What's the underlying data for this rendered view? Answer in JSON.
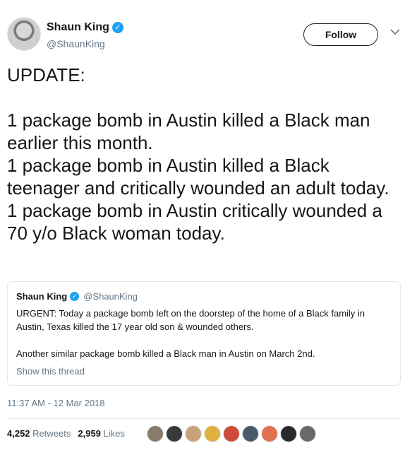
{
  "author": {
    "name": "Shaun King",
    "handle": "@ShaunKing",
    "verified_icon": "verified-badge-icon"
  },
  "actions": {
    "follow_label": "Follow",
    "more_icon": "chevron-down-icon"
  },
  "tweet": {
    "text": "UPDATE:\n\n1 package bomb in Austin killed a Black man earlier this month.\n1 package bomb in Austin killed a Black teenager and critically wounded an adult today.\n1 package bomb in Austin critically wounded a 70 y/o Black woman today."
  },
  "quoted": {
    "name": "Shaun King",
    "handle": "@ShaunKing",
    "text": "URGENT: Today a package bomb left on the doorstep of the home of a Black family in Austin, Texas killed the 17 year old son & wounded others.\n\nAnother similar package bomb killed a Black man in Austin on March 2nd.",
    "show_thread": "Show this thread"
  },
  "meta": {
    "timestamp": "11:37 AM - 12 Mar 2018",
    "retweets_count": "4,252",
    "retweets_label": "Retweets",
    "likes_count": "2,959",
    "likes_label": "Likes"
  },
  "likers": [
    {
      "color": "#8a7a6a"
    },
    {
      "color": "#3a3a3a"
    },
    {
      "color": "#c9a27a"
    },
    {
      "color": "#e0b040"
    },
    {
      "color": "#d04a3a"
    },
    {
      "color": "#4a5a6a"
    },
    {
      "color": "#e07050"
    },
    {
      "color": "#2a2a2a"
    },
    {
      "color": "#6a6a6a"
    }
  ],
  "colors": {
    "accent": "#1da1f2",
    "muted": "#657786",
    "border": "#e1e8ed"
  }
}
